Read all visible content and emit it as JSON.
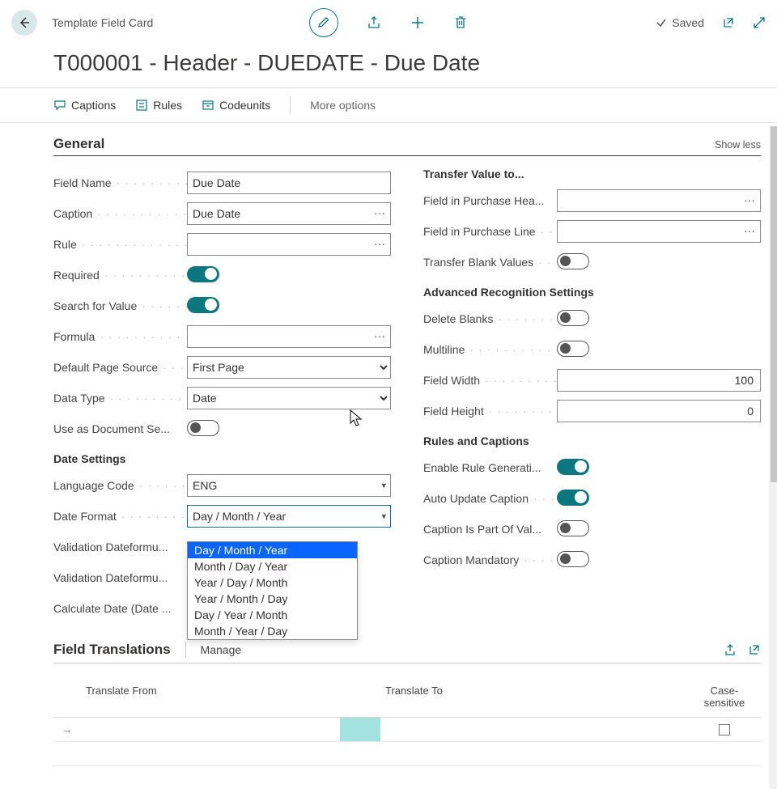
{
  "topbar": {
    "breadcrumb": "Template Field Card",
    "saved_label": "Saved"
  },
  "page_title": "T000001 - Header - DUEDATE - Due Date",
  "actions": {
    "captions": "Captions",
    "rules": "Rules",
    "codeunits": "Codeunits",
    "more": "More options"
  },
  "general": {
    "title": "General",
    "show_less": "Show less",
    "left": {
      "field_name_label": "Field Name",
      "field_name_value": "Due Date",
      "caption_label": "Caption",
      "caption_value": "Due Date",
      "rule_label": "Rule",
      "rule_value": "",
      "required_label": "Required",
      "search_label": "Search for Value",
      "formula_label": "Formula",
      "formula_value": "",
      "default_page_source_label": "Default Page Source",
      "default_page_source_value": "First Page",
      "data_type_label": "Data Type",
      "data_type_value": "Date",
      "use_doc_sep_label": "Use as Document Se...",
      "date_settings_header": "Date Settings",
      "lang_label": "Language Code",
      "lang_value": "ENG",
      "date_format_label": "Date Format",
      "date_format_value": "Day / Month / Year",
      "date_format_options": [
        "Day / Month / Year",
        "Month / Day / Year",
        "Year / Day / Month",
        "Year / Month / Day",
        "Day / Year / Month",
        "Month / Year / Day"
      ],
      "validation_df1_label": "Validation Dateformu...",
      "validation_df2_label": "Validation Dateformu...",
      "calc_date_label": "Calculate Date (Date ..."
    },
    "right": {
      "transfer_header": "Transfer Value to...",
      "fph_label": "Field in Purchase Hea...",
      "fpl_label": "Field in Purchase Line",
      "tbv_label": "Transfer Blank Values",
      "ars_header": "Advanced Recognition Settings",
      "del_blanks_label": "Delete Blanks",
      "multiline_label": "Multiline",
      "field_width_label": "Field Width",
      "field_width_value": "100",
      "field_height_label": "Field Height",
      "field_height_value": "0",
      "rc_header": "Rules and Captions",
      "enable_rule_label": "Enable Rule Generati...",
      "auto_update_label": "Auto Update Caption",
      "cap_part_label": "Caption Is Part Of Val...",
      "cap_mand_label": "Caption Mandatory"
    }
  },
  "translations": {
    "title": "Field Translations",
    "manage": "Manage",
    "col_from": "Translate From",
    "col_to": "Translate To",
    "col_case": "Case-sensitive"
  }
}
